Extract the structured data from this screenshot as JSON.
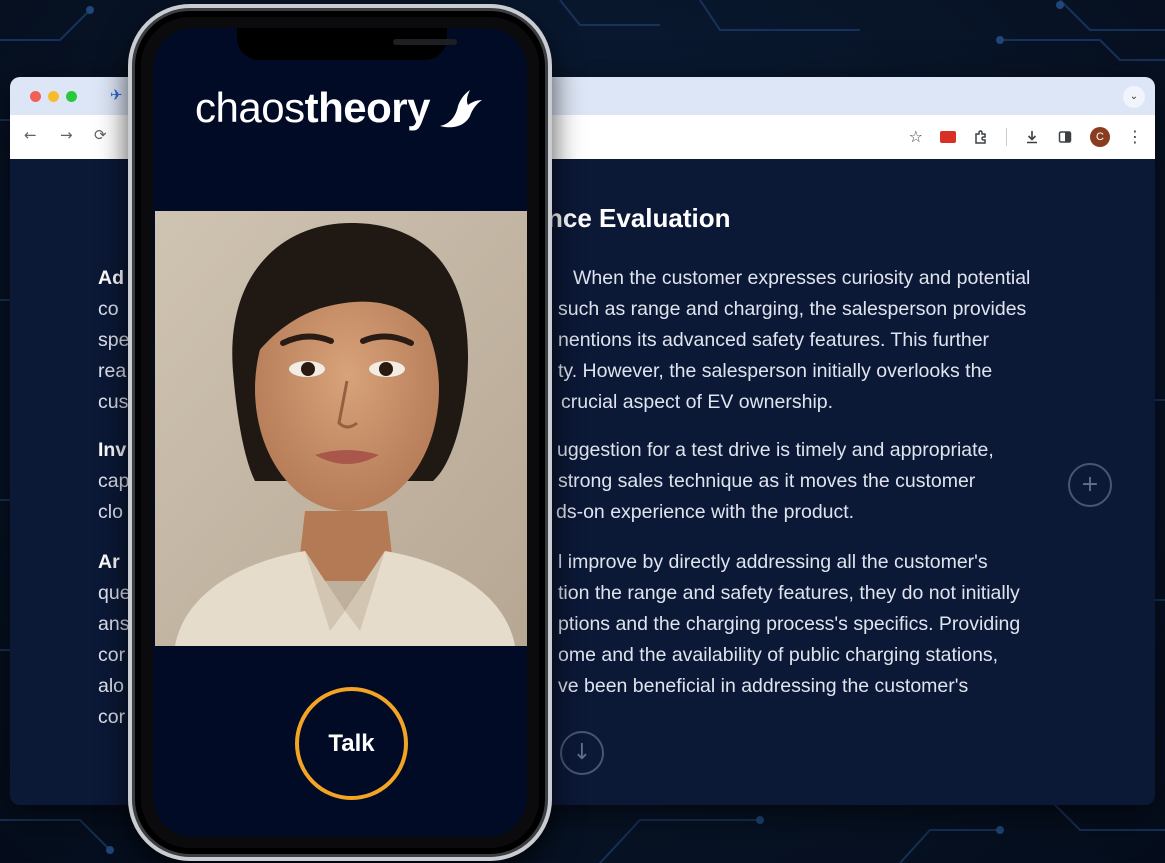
{
  "browser": {
    "nav": {
      "back": "←",
      "forward": "→",
      "reload": "⟳"
    },
    "tabbar_chevron": "⌄"
  },
  "page": {
    "title": "nce Evaluation",
    "sections": [
      {
        "heading": "Ad",
        "lines": [
          "When the customer expresses curiosity and potential",
          "co",
          "such as range and charging, the salesperson provides",
          "spe",
          "nentions its advanced safety features. This further",
          "rea",
          "ty. However, the salesperson initially overlooks the",
          "cus",
          "crucial aspect of EV ownership."
        ]
      },
      {
        "heading": "Inv",
        "lines": [
          "uggestion for a test drive is timely and appropriate,",
          "cap",
          "strong sales technique as it moves the customer",
          "clo",
          "ds-on experience with the product."
        ]
      },
      {
        "heading": "Ar",
        "lines": [
          "l improve by directly addressing all the customer's",
          "que",
          "tion the range and safety features, they do not initially",
          "ans",
          "ptions and the charging process's specifics. Providing",
          "cor",
          "ome and the availability of public charging stations,",
          "alo",
          "ve been beneficial in addressing the customer's",
          "cor"
        ]
      }
    ],
    "add_button_symbol": "+",
    "down_button_symbol": "↓"
  },
  "phone": {
    "brand_light": "chaos",
    "brand_bold": "theory",
    "talk_label": "Talk"
  },
  "colors": {
    "accent": "#f3a424",
    "screen_bg": "#020b26",
    "page_bg": "#0b1836"
  },
  "icons": [
    "bookmark-star-icon",
    "extension-puzzle-icon",
    "download-icon",
    "side-panel-icon",
    "profile-avatar-icon",
    "more-menu-icon"
  ],
  "avatar_letter": "C"
}
